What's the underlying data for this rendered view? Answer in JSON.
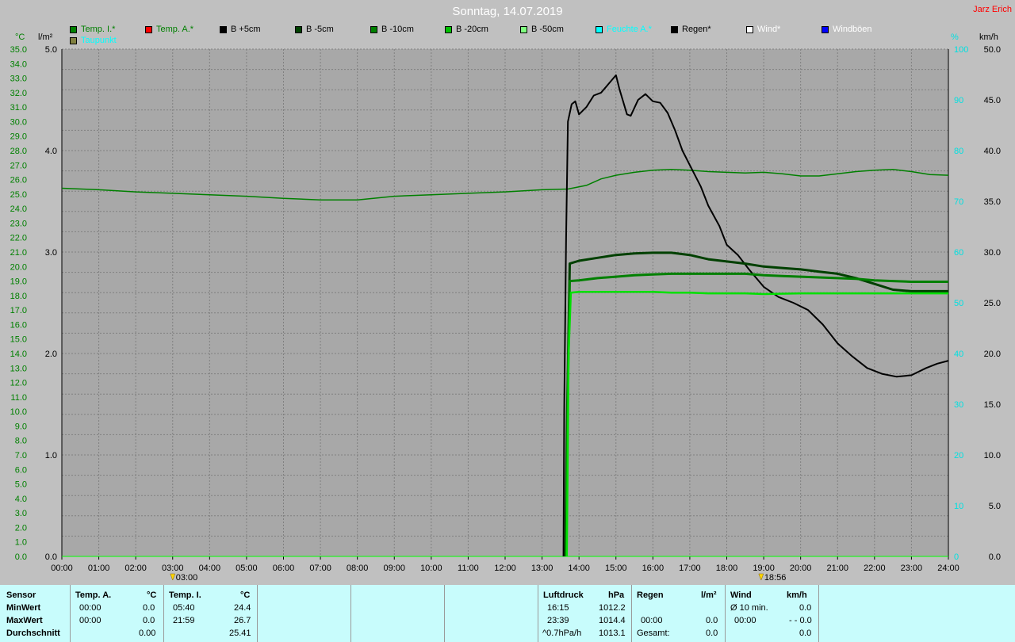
{
  "header": {
    "title": "Sonntag, 14.07.2019",
    "author": "Jarz Erich"
  },
  "legend": [
    {
      "label": "Temp. I.*",
      "color": "#008000"
    },
    {
      "label": "Temp. A.*",
      "color": "#ff0000"
    },
    {
      "label": "B +5cm",
      "color": "#000000"
    },
    {
      "label": "B -5cm",
      "color": "#004000"
    },
    {
      "label": "B -10cm",
      "color": "#008000"
    },
    {
      "label": "B -20cm",
      "color": "#00c000"
    },
    {
      "label": "B -50cm",
      "color": "#80ff80"
    },
    {
      "label": "Feuchte A.*",
      "color": "#00ffff"
    },
    {
      "label": "Regen*",
      "color": "#000000"
    },
    {
      "label": "Wind*",
      "color": "#ffffff"
    },
    {
      "label": "Windböen",
      "color": "#0000ff"
    },
    {
      "label": "Taupunkt",
      "color": "#808040"
    }
  ],
  "units": {
    "temp": "°C",
    "rain": "l/m²",
    "humidity": "%",
    "wind": "km/h"
  },
  "chart_data": {
    "type": "line",
    "xlabel": "",
    "ylabel": "",
    "x_ticks": [
      "00:00",
      "01:00",
      "02:00",
      "03:00",
      "04:00",
      "05:00",
      "06:00",
      "07:00",
      "08:00",
      "09:00",
      "10:00",
      "11:00",
      "12:00",
      "13:00",
      "14:00",
      "15:00",
      "16:00",
      "17:00",
      "18:00",
      "19:00",
      "20:00",
      "21:00",
      "22:00",
      "23:00",
      "24:00"
    ],
    "xlim": [
      0,
      24
    ],
    "ylim_temp": [
      0,
      35
    ],
    "y_ticks_temp": [
      "0.0",
      "1.0",
      "2.0",
      "3.0",
      "4.0",
      "5.0",
      "6.0",
      "7.0",
      "8.0",
      "9.0",
      "10.0",
      "11.0",
      "12.0",
      "13.0",
      "14.0",
      "15.0",
      "16.0",
      "17.0",
      "18.0",
      "19.0",
      "20.0",
      "21.0",
      "22.0",
      "23.0",
      "24.0",
      "25.0",
      "26.0",
      "27.0",
      "28.0",
      "29.0",
      "30.0",
      "31.0",
      "32.0",
      "33.0",
      "34.0",
      "35.0"
    ],
    "ylim_rain": [
      0,
      5
    ],
    "y_ticks_rain": [
      "0.0",
      "1.0",
      "2.0",
      "3.0",
      "4.0",
      "5.0"
    ],
    "ylim_humidity": [
      0,
      100
    ],
    "y_ticks_humidity": [
      "0",
      "10",
      "20",
      "30",
      "40",
      "50",
      "60",
      "70",
      "80",
      "90",
      "100"
    ],
    "ylim_wind": [
      0,
      50
    ],
    "y_ticks_wind": [
      "0.0",
      "5.0",
      "10.0",
      "15.0",
      "20.0",
      "25.0",
      "30.0",
      "35.0",
      "40.0",
      "45.0",
      "50.0"
    ],
    "grid": true,
    "markers": [
      {
        "label": "03:00",
        "x": 3.0
      },
      {
        "label": "18:56",
        "x": 18.93
      }
    ],
    "series": [
      {
        "name": "Temp. I.*",
        "color": "#008000",
        "x": [
          0,
          1,
          2,
          3,
          4,
          5,
          6,
          7,
          8,
          9,
          10,
          11,
          12,
          13,
          13.7,
          14.2,
          14.6,
          15,
          15.5,
          16,
          16.5,
          17,
          17.5,
          18,
          18.5,
          19,
          19.5,
          20,
          20.5,
          21,
          21.5,
          22,
          22.5,
          23,
          23.5,
          24
        ],
        "y": [
          25.4,
          25.3,
          25.15,
          25.05,
          24.95,
          24.85,
          24.7,
          24.6,
          24.6,
          24.85,
          24.95,
          25.05,
          25.15,
          25.3,
          25.35,
          25.6,
          26.05,
          26.3,
          26.5,
          26.65,
          26.7,
          26.65,
          26.55,
          26.5,
          26.45,
          26.5,
          26.4,
          26.25,
          26.25,
          26.4,
          26.55,
          26.65,
          26.7,
          26.55,
          26.35,
          26.3
        ]
      },
      {
        "name": "B +5cm",
        "color": "#000000",
        "x": [
          13.58,
          13.6,
          13.65,
          13.7,
          13.8,
          13.9,
          14.0,
          14.2,
          14.4,
          14.6,
          14.8,
          15.0,
          15.1,
          15.3,
          15.4,
          15.6,
          15.8,
          16.0,
          16.2,
          16.4,
          16.6,
          16.8,
          17.0,
          17.3,
          17.5,
          17.8,
          18.0,
          18.3,
          18.6,
          19.0,
          19.4,
          19.8,
          20.2,
          20.6,
          21.0,
          21.4,
          21.8,
          22.2,
          22.6,
          23.0,
          23.4,
          23.7,
          24.0
        ],
        "y": [
          0.0,
          10.0,
          22.0,
          30.0,
          31.2,
          31.4,
          30.5,
          31.0,
          31.8,
          32.0,
          32.6,
          33.2,
          32.2,
          30.5,
          30.4,
          31.5,
          31.9,
          31.4,
          31.3,
          30.6,
          29.4,
          28.0,
          27.0,
          25.5,
          24.2,
          22.8,
          21.5,
          20.8,
          19.8,
          18.6,
          17.9,
          17.5,
          17.0,
          16.0,
          14.7,
          13.8,
          13.0,
          12.6,
          12.4,
          12.5,
          13.0,
          13.3,
          13.5
        ]
      },
      {
        "name": "B -5cm",
        "color": "#004000",
        "x": [
          13.63,
          13.68,
          13.75,
          14.0,
          14.5,
          15.0,
          15.5,
          16.0,
          16.5,
          17.0,
          17.5,
          18.0,
          18.5,
          19.0,
          19.5,
          20.0,
          20.5,
          21.0,
          21.5,
          22.0,
          22.5,
          23.0,
          23.5,
          24.0
        ],
        "y": [
          0.0,
          10.0,
          20.2,
          20.4,
          20.6,
          20.8,
          20.9,
          20.95,
          20.95,
          20.8,
          20.5,
          20.35,
          20.2,
          20.0,
          19.9,
          19.8,
          19.65,
          19.5,
          19.2,
          18.8,
          18.4,
          18.3,
          18.3,
          18.3
        ]
      },
      {
        "name": "B -10cm",
        "color": "#008000",
        "x": [
          13.65,
          13.7,
          13.75,
          14.0,
          14.5,
          15.0,
          15.5,
          16.0,
          16.5,
          17.0,
          17.5,
          18.0,
          18.5,
          19.0,
          19.5,
          20.0,
          20.5,
          21.0,
          21.5,
          22.0,
          22.5,
          23.0,
          23.5,
          24.0
        ],
        "y": [
          0.0,
          12.0,
          19.0,
          19.05,
          19.2,
          19.3,
          19.4,
          19.45,
          19.5,
          19.5,
          19.5,
          19.5,
          19.5,
          19.4,
          19.35,
          19.3,
          19.25,
          19.2,
          19.15,
          19.05,
          19.0,
          18.95,
          18.95,
          18.95
        ]
      },
      {
        "name": "B -20cm",
        "color": "#00e000",
        "x": [
          13.67,
          13.72,
          13.78,
          14.0,
          15.0,
          16.0,
          16.5,
          17.0,
          17.5,
          18.0,
          18.5,
          19.0,
          20.0,
          21.0,
          22.0,
          23.0,
          24.0
        ],
        "y": [
          0.0,
          14.0,
          18.2,
          18.25,
          18.25,
          18.25,
          18.2,
          18.2,
          18.15,
          18.15,
          18.15,
          18.1,
          18.15,
          18.15,
          18.15,
          18.15,
          18.15
        ]
      }
    ]
  },
  "table": {
    "sensor_header": "Sensor",
    "rows": [
      "MinWert",
      "MaxWert",
      "Durchschnitt"
    ],
    "temp_a": {
      "header": "Temp. A.",
      "unit": "°C",
      "min_time": "00:00",
      "min_val": "0.0",
      "max_time": "00:00",
      "max_val": "0.0",
      "avg": "0.00"
    },
    "temp_i": {
      "header": "Temp. I.",
      "unit": "°C",
      "min_time": "05:40",
      "min_val": "24.4",
      "max_time": "21:59",
      "max_val": "26.7",
      "avg": "25.41"
    },
    "pressure": {
      "header": "Luftdruck",
      "unit": "hPa",
      "min_time": "16:15",
      "min_val": "1012.2",
      "max_time": "23:39",
      "max_val": "1014.4",
      "avg_label": "^0.7hPa/h",
      "avg": "1013.1"
    },
    "rain": {
      "header": "Regen",
      "unit": "l/m²",
      "max_time": "00:00",
      "max_val": "0.0",
      "avg_label": "Gesamt:",
      "avg": "0.0",
      "min_val": "0.0"
    },
    "wind": {
      "header": "Wind",
      "unit": "km/h",
      "min_label": "Ø 10 min.",
      "min_val": "0.0",
      "max_time": "00:00",
      "max_val": "- - 0.0",
      "avg": "0.0"
    }
  }
}
